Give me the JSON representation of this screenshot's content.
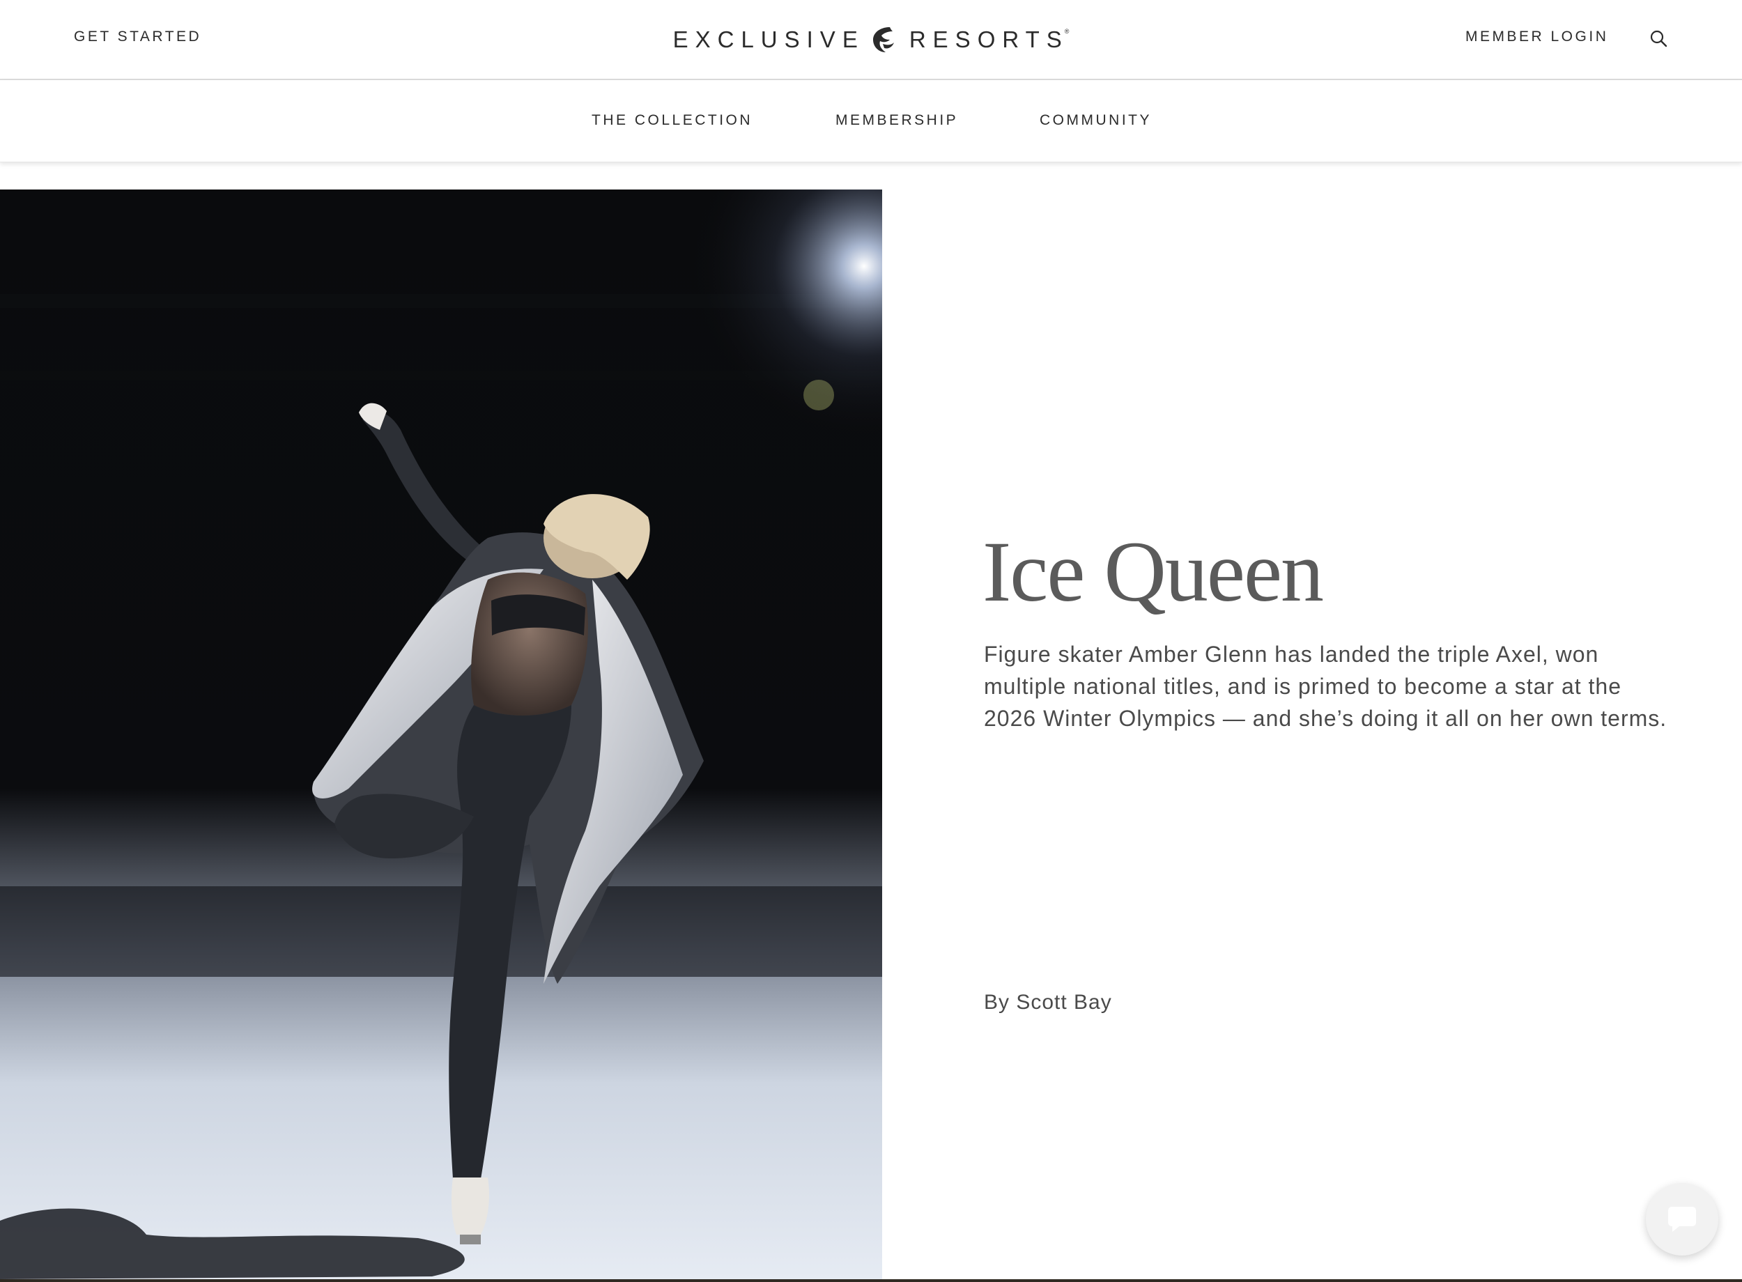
{
  "header": {
    "get_started_label": "GET STARTED",
    "brand_left": "EXCLUSIVE",
    "brand_right": "RESORTS",
    "brand_reg": "®",
    "member_login_label": "MEMBER LOGIN",
    "search_icon": "search-icon"
  },
  "nav": {
    "items": [
      {
        "label": "THE COLLECTION"
      },
      {
        "label": "MEMBERSHIP"
      },
      {
        "label": "COMMUNITY"
      }
    ]
  },
  "article": {
    "title": "Ice Queen",
    "dek": "Figure skater Amber Glenn has landed the triple Axel, won multiple national titles, and is primed to become a star at the 2026 Winter Olympics — and she’s doing it all on her own terms.",
    "byline": "By Scott Bay"
  },
  "chat": {
    "icon": "chat-bubble-icon"
  },
  "colors": {
    "text": "#2b2b2b",
    "title": "#5b5b5b",
    "body": "#4a4a4a",
    "hero_bg": "#050607",
    "ice": "#dfe5ee"
  }
}
